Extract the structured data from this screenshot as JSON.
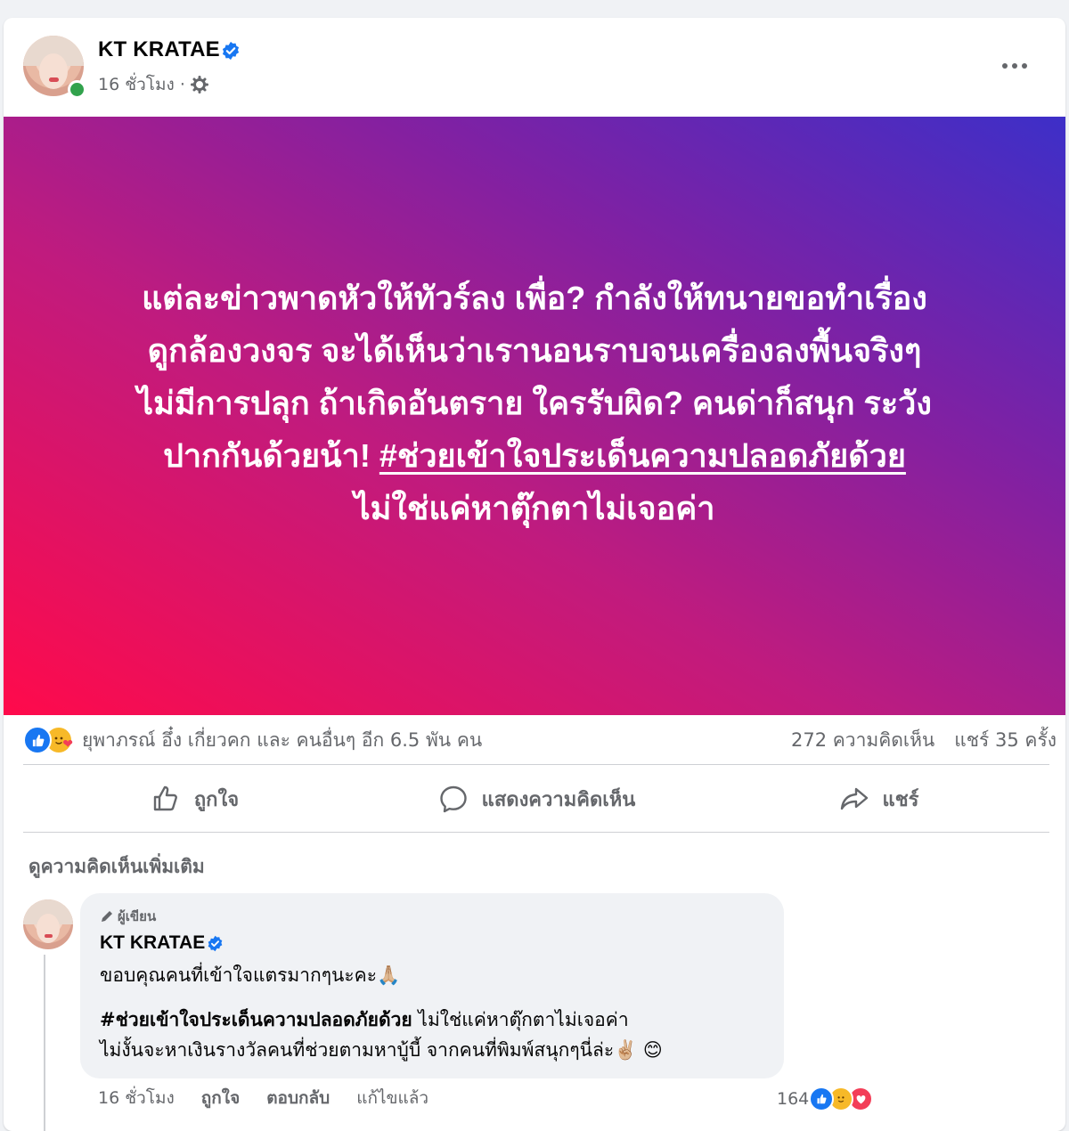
{
  "post": {
    "author_name": "KT KRATAE",
    "time": "16 ชั่วโมง ·",
    "banner_text_line1": "แต่ละข่าวพาดหัวให้ทัวร์ลง เพื่อ? กำลังให้ทนายขอทำเรื่อง",
    "banner_text_line2": "ดูกล้องวงจร จะได้เห็นว่าเรานอนราบจนเครื่องลงพื้นจริงๆ",
    "banner_text_line3": "ไม่มีการปลุก ถ้าเกิดอันตราย ใครรับผิด? คนด่าก็สนุก ระวัง",
    "banner_text_line4_prefix": "ปากกันด้วยน้า! ",
    "banner_hashtag": "#ช่วยเข้าใจประเด็นความปลอดภัยด้วย",
    "banner_text_line5": "ไม่ใช่แค่หาตุ๊กตาไม่เจอค่า",
    "banner_gradient": [
      "#ff0a4b",
      "#3d2fc8"
    ]
  },
  "stats": {
    "reactions_text": "ยุพาภรณ์ อึ๋ง เกี่ยวคก และ คนอื่นๆ อีก 6.5 พัน คน",
    "comments": "272 ความคิดเห็น",
    "shares": "แชร์ 35 ครั้ง"
  },
  "actions": {
    "like": "ถูกใจ",
    "comment": "แสดงความคิดเห็น",
    "share": "แชร์"
  },
  "comments_section": {
    "see_more": "ดูความคิดเห็นเพิ่มเติม",
    "comment": {
      "author_tag": "ผู้เขียน",
      "author_name": "KT KRATAE",
      "line1": "ขอบคุณคนที่เข้าใจแตรมากๆนะคะ🙏🏼",
      "hashtag": "#ช่วยเข้าใจประเด็นความปลอดภัยด้วย",
      "line2_suffix": " ไม่ใช่แค่หาตุ๊กตาไม่เจอค่า",
      "line3": "ไม่งั้นจะหาเงินรางวัลคนที่ช่วยตามหาบู้บี้ จากคนที่พิมพ์สนุกๆนี่ล่ะ✌🏼 😊",
      "time": "16 ชั่วโมง",
      "like_label": "ถูกใจ",
      "reply_label": "ตอบกลับ",
      "edited_label": "แก้ไขแล้ว",
      "reaction_count": "164"
    }
  },
  "colors": {
    "facebook_blue": "#1877f2",
    "online_green": "#31a24c",
    "secondary_text": "#65676b"
  },
  "icons": [
    "verified-badge-icon",
    "globe-settings-icon",
    "more-icon",
    "like-icon",
    "care-icon",
    "love-icon",
    "comment-icon",
    "share-icon",
    "pencil-icon"
  ]
}
